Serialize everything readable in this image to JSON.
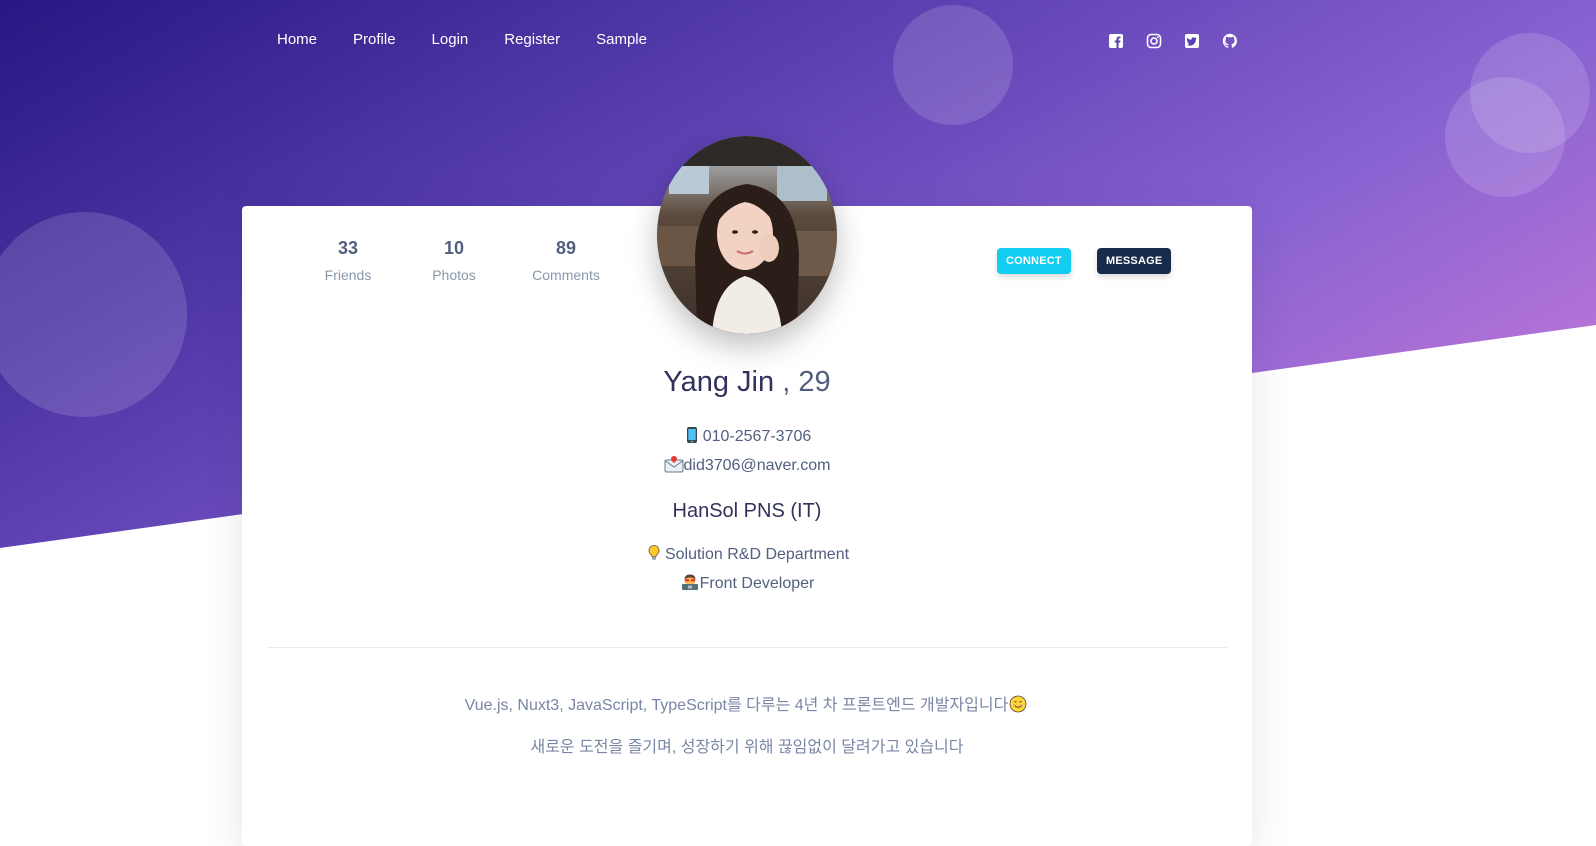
{
  "nav": {
    "items": [
      "Home",
      "Profile",
      "Login",
      "Register",
      "Sample"
    ]
  },
  "social": {
    "icons": [
      "facebook-square-icon",
      "instagram-icon",
      "twitter-square-icon",
      "github-icon"
    ]
  },
  "profile": {
    "stats": [
      {
        "value": "33",
        "label": "Friends"
      },
      {
        "value": "10",
        "label": "Photos"
      },
      {
        "value": "89",
        "label": "Comments"
      }
    ],
    "buttons": {
      "connect": "CONNECT",
      "message": "MESSAGE"
    },
    "name": "Yang Jin",
    "age": ", 29",
    "phone": "010-2567-3706",
    "email": "did3706@naver.com",
    "company": "HanSol PNS (IT)",
    "department": "Solution R&D Department",
    "role": "Front Developer",
    "bio_line1": "Vue.js, Nuxt3, JavaScript, TypeScript를 다루는 4년 차 프론트엔드 개발자입니다",
    "bio_line2": "새로운 도전을 즐기며, 성장하기 위해 끊임없이 달려가고 있습니다"
  },
  "colors": {
    "connect": "#11cdef",
    "message": "#172b4d",
    "gradient_start": "#281782",
    "gradient_end": "#d47fd9"
  }
}
